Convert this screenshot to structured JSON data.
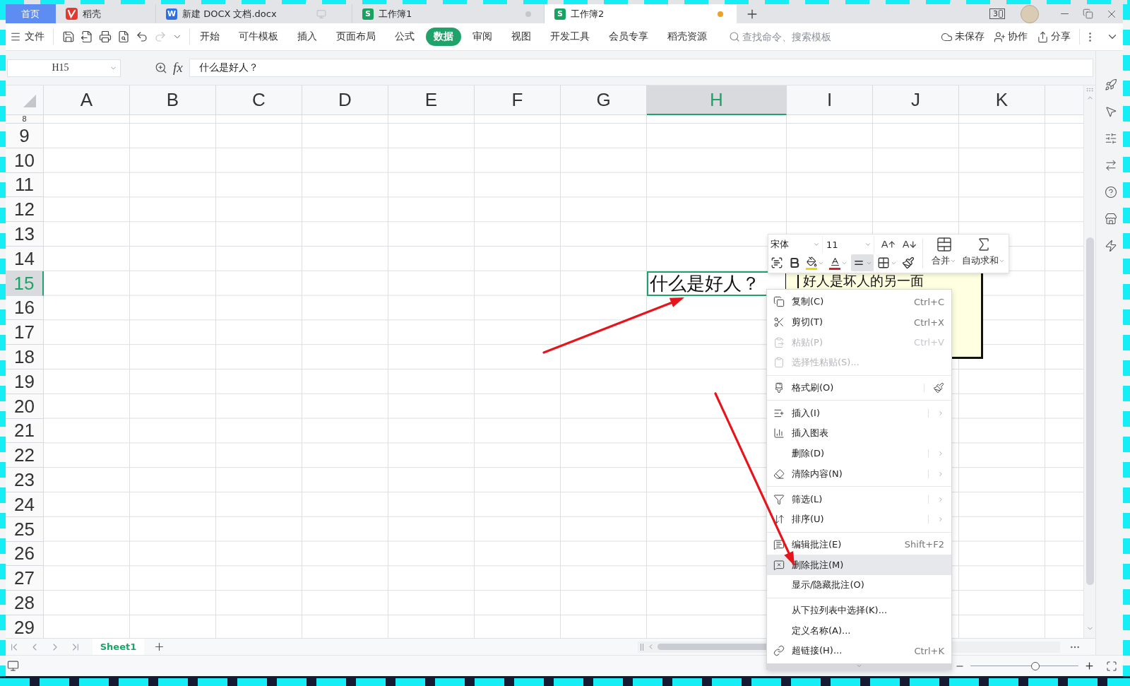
{
  "tabs": [
    {
      "label": "首页",
      "kind": "home",
      "selected": false
    },
    {
      "label": "稻壳",
      "kind": "docer",
      "selected": false
    },
    {
      "label": "新建 DOCX 文档.docx",
      "kind": "writer",
      "icon_text": "W",
      "selected": false
    },
    {
      "label": "工作簿1",
      "kind": "sheet",
      "icon_text": "S",
      "selected": false,
      "color": "#c3c6cc"
    },
    {
      "label": "工作簿2",
      "kind": "sheet",
      "icon_text": "S",
      "selected": true,
      "color": "#f0a023"
    }
  ],
  "window": {
    "device_badge": "3"
  },
  "ribbon": {
    "file_menu": "文件",
    "quick_access": [
      {
        "disabled": false
      },
      {
        "disabled": false
      },
      {
        "disabled": false
      },
      {
        "disabled": false
      },
      {
        "disabled": false
      },
      {
        "disabled": true
      }
    ],
    "tabs": [
      {
        "label": "开始",
        "selected": false
      },
      {
        "label": "可牛模板",
        "selected": false
      },
      {
        "label": "插入",
        "selected": false
      },
      {
        "label": "页面布局",
        "selected": false
      },
      {
        "label": "公式",
        "selected": false
      },
      {
        "label": "数据",
        "selected": true
      },
      {
        "label": "审阅",
        "selected": false
      },
      {
        "label": "视图",
        "selected": false
      },
      {
        "label": "开发工具",
        "selected": false
      },
      {
        "label": "会员专享",
        "selected": false
      },
      {
        "label": "稻壳资源",
        "selected": false
      }
    ],
    "search": {
      "placeholder": "查找命令、搜索模板"
    },
    "actions": [
      "未保存",
      "协作",
      "分享"
    ]
  },
  "formula_bar": {
    "name_box": "H15",
    "function_label": "fx",
    "formula": "什么是好人？"
  },
  "sheet": {
    "columns": [
      {
        "label": "A",
        "selected": false
      },
      {
        "label": "B",
        "selected": false
      },
      {
        "label": "C",
        "selected": false
      },
      {
        "label": "D",
        "selected": false
      },
      {
        "label": "E",
        "selected": false
      },
      {
        "label": "F",
        "selected": false
      },
      {
        "label": "G",
        "selected": false
      },
      {
        "label": "H",
        "selected": true
      },
      {
        "label": "I",
        "selected": false
      },
      {
        "label": "J",
        "selected": false
      },
      {
        "label": "K",
        "selected": false
      }
    ],
    "rows": [
      {
        "label": "8",
        "selected": false
      },
      {
        "label": "9",
        "selected": false
      },
      {
        "label": "10",
        "selected": false
      },
      {
        "label": "11",
        "selected": false
      },
      {
        "label": "12",
        "selected": false
      },
      {
        "label": "13",
        "selected": false
      },
      {
        "label": "14",
        "selected": false
      },
      {
        "label": "15",
        "selected": true
      },
      {
        "label": "16",
        "selected": false
      },
      {
        "label": "17",
        "selected": false
      },
      {
        "label": "18",
        "selected": false
      },
      {
        "label": "19",
        "selected": false
      },
      {
        "label": "20",
        "selected": false
      },
      {
        "label": "21",
        "selected": false
      },
      {
        "label": "22",
        "selected": false
      },
      {
        "label": "23",
        "selected": false
      },
      {
        "label": "24",
        "selected": false
      },
      {
        "label": "25",
        "selected": false
      },
      {
        "label": "26",
        "selected": false
      },
      {
        "label": "27",
        "selected": false
      },
      {
        "label": "28",
        "selected": false
      },
      {
        "label": "29",
        "selected": false
      }
    ],
    "active_cell": {
      "value": "什么是好人？"
    },
    "comment": {
      "text": "好人是坏人的另一面"
    }
  },
  "mini_toolbar": {
    "font": "宋体",
    "size": "11",
    "tools": [
      {
        "dropdown": false,
        "selected": false
      },
      {
        "dropdown": false,
        "selected": false
      },
      {
        "dropdown": true,
        "selected": false
      },
      {
        "dropdown": true,
        "selected": false
      },
      {
        "dropdown": true,
        "selected": true
      },
      {
        "dropdown": true,
        "selected": false
      },
      {
        "dropdown": false,
        "selected": false
      }
    ],
    "merge": "合并",
    "autosum": "自动求和"
  },
  "context_menu": {
    "groups": [
      {
        "items": [
          {
            "label": "复制(C)",
            "shortcut": "Ctrl+C",
            "disabled": false,
            "selected": false,
            "submenu": false
          },
          {
            "label": "剪切(T)",
            "shortcut": "Ctrl+X",
            "disabled": false,
            "selected": false,
            "submenu": false
          },
          {
            "label": "粘贴(P)",
            "shortcut": "Ctrl+V",
            "disabled": true,
            "selected": false,
            "submenu": false
          },
          {
            "label": "选择性粘贴(S)...",
            "disabled": true,
            "selected": false,
            "submenu": false
          }
        ]
      },
      {
        "items": [
          {
            "label": "格式刷(O)",
            "disabled": false,
            "selected": false,
            "submenu": false
          }
        ]
      },
      {
        "items": [
          {
            "label": "插入(I)",
            "disabled": false,
            "selected": false,
            "submenu": true
          },
          {
            "label": "插入图表",
            "disabled": false,
            "selected": false,
            "submenu": false
          },
          {
            "label": "删除(D)",
            "disabled": false,
            "selected": false,
            "submenu": true
          },
          {
            "label": "清除内容(N)",
            "disabled": false,
            "selected": false,
            "submenu": true
          }
        ]
      },
      {
        "items": [
          {
            "label": "筛选(L)",
            "disabled": false,
            "selected": false,
            "submenu": true
          },
          {
            "label": "排序(U)",
            "disabled": false,
            "selected": false,
            "submenu": true
          }
        ]
      },
      {
        "items": [
          {
            "label": "编辑批注(E)",
            "shortcut": "Shift+F2",
            "disabled": false,
            "selected": false,
            "submenu": false
          },
          {
            "label": "删除批注(M)",
            "disabled": false,
            "selected": true,
            "submenu": false
          },
          {
            "label": "显示/隐藏批注(O)",
            "disabled": false,
            "selected": false,
            "submenu": false
          }
        ]
      },
      {
        "items": [
          {
            "label": "从下拉列表中选择(K)...",
            "disabled": false,
            "selected": false,
            "submenu": false
          },
          {
            "label": "定义名称(A)...",
            "disabled": false,
            "selected": false,
            "submenu": false
          },
          {
            "label": "超链接(H)...",
            "shortcut": "Ctrl+K",
            "disabled": false,
            "selected": false,
            "submenu": false
          }
        ]
      }
    ]
  },
  "sheet_tabs": [
    {
      "label": "Sheet1",
      "selected": true
    }
  ],
  "status_bar": {
    "zoom": {
      "level": 0.6
    }
  }
}
